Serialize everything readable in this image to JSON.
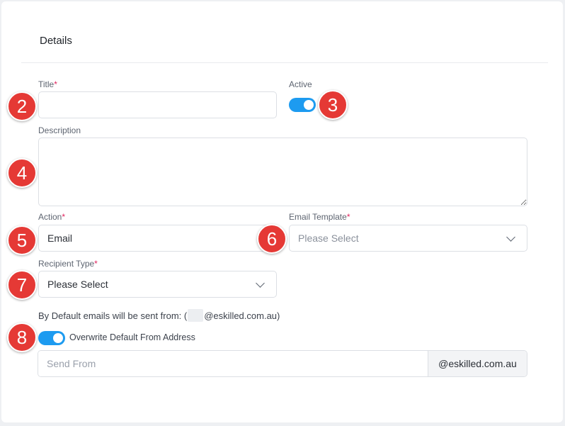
{
  "section": {
    "title": "Details"
  },
  "title_field": {
    "label": "Title",
    "required_mark": "*",
    "value": "",
    "placeholder": ""
  },
  "active": {
    "label": "Active",
    "on": true
  },
  "description": {
    "label": "Description",
    "value": ""
  },
  "action": {
    "label": "Action",
    "required_mark": "*",
    "value": "Email"
  },
  "email_template": {
    "label": "Email Template",
    "required_mark": "*",
    "value": "Please Select"
  },
  "recipient_type": {
    "label": "Recipient Type",
    "required_mark": "*",
    "value": "Please Select"
  },
  "default_from": {
    "prefix": "By Default emails will be sent from: (",
    "suffix": "@eskilled.com.au)"
  },
  "overwrite": {
    "label": "Overwrite Default From Address",
    "on": true
  },
  "send_from": {
    "placeholder": "Send From",
    "value": "",
    "domain": "@eskilled.com.au"
  },
  "badges": [
    "2",
    "3",
    "4",
    "5",
    "6",
    "7",
    "8"
  ],
  "colors": {
    "accent": "#1d9bf0",
    "required": "#e0245e",
    "badge": "#e53935"
  }
}
